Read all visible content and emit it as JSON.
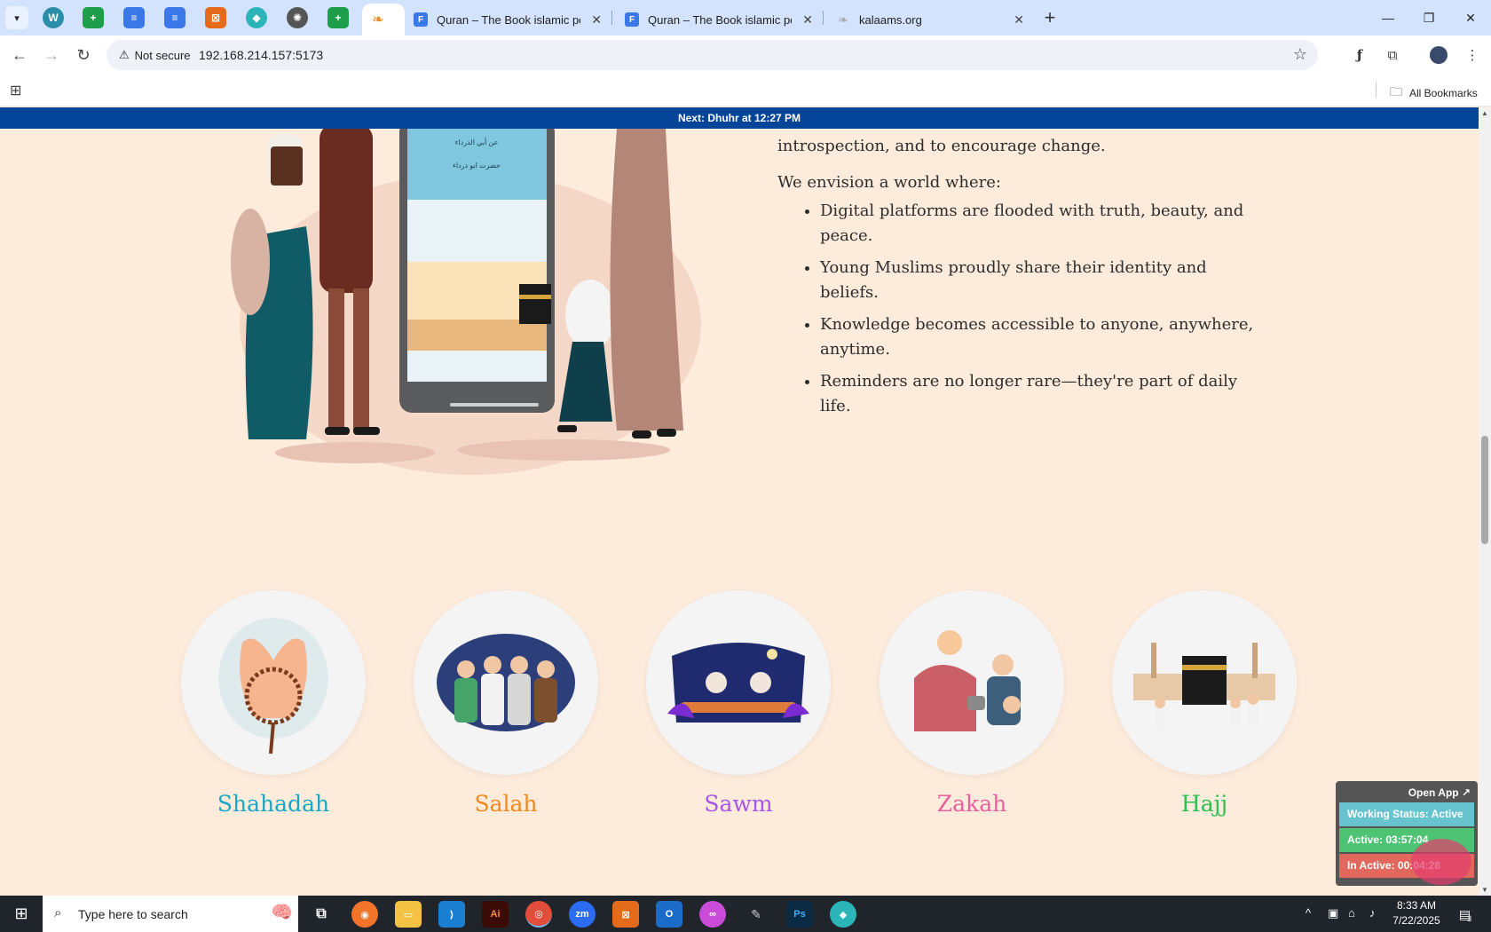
{
  "browser": {
    "tabs": [
      {
        "title": "Quran – The Book islamic peop"
      },
      {
        "title": "Quran – The Book islamic peop"
      },
      {
        "title": "kalaams.org"
      }
    ],
    "address": {
      "security_label": "Not secure",
      "url": "192.168.214.157:5173"
    },
    "bookmarks": {
      "all_label": "All Bookmarks"
    }
  },
  "announcement": {
    "prefix": "Next:",
    "prayer": "Dhuhr",
    "suffix": "at 12:27 PM"
  },
  "vision": {
    "intro": "introspection, and to encourage change.",
    "envision": "We envision a world where:",
    "items": [
      "Digital platforms are flooded with truth, beauty, and peace.",
      "Young Muslims proudly share their identity and beliefs.",
      "Knowledge becomes accessible to anyone, anywhere, anytime.",
      "Reminders are no longer rare—they're part of daily life."
    ]
  },
  "pillars": [
    {
      "name": "Shahadah",
      "color": "#17a8c4"
    },
    {
      "name": "Salah",
      "color": "#f08a1c"
    },
    {
      "name": "Sawm",
      "color": "#a955e8"
    },
    {
      "name": "Zakah",
      "color": "#ec5f9f"
    },
    {
      "name": "Hajj",
      "color": "#2fbf50"
    }
  ],
  "widget": {
    "open_label": "Open App ↗",
    "working_status": "Working Status: Active",
    "active": "Active: 03:57:04",
    "inactive": "In Active: 00:04:28"
  },
  "taskbar": {
    "search_placeholder": "Type here to search",
    "time": "8:33 AM",
    "date": "7/22/2025",
    "notification_count": "3"
  },
  "colors": {
    "page_bg": "#fdebdc",
    "announcement_bg": "#04459a",
    "tabstrip_bg": "#d3e3fd"
  }
}
